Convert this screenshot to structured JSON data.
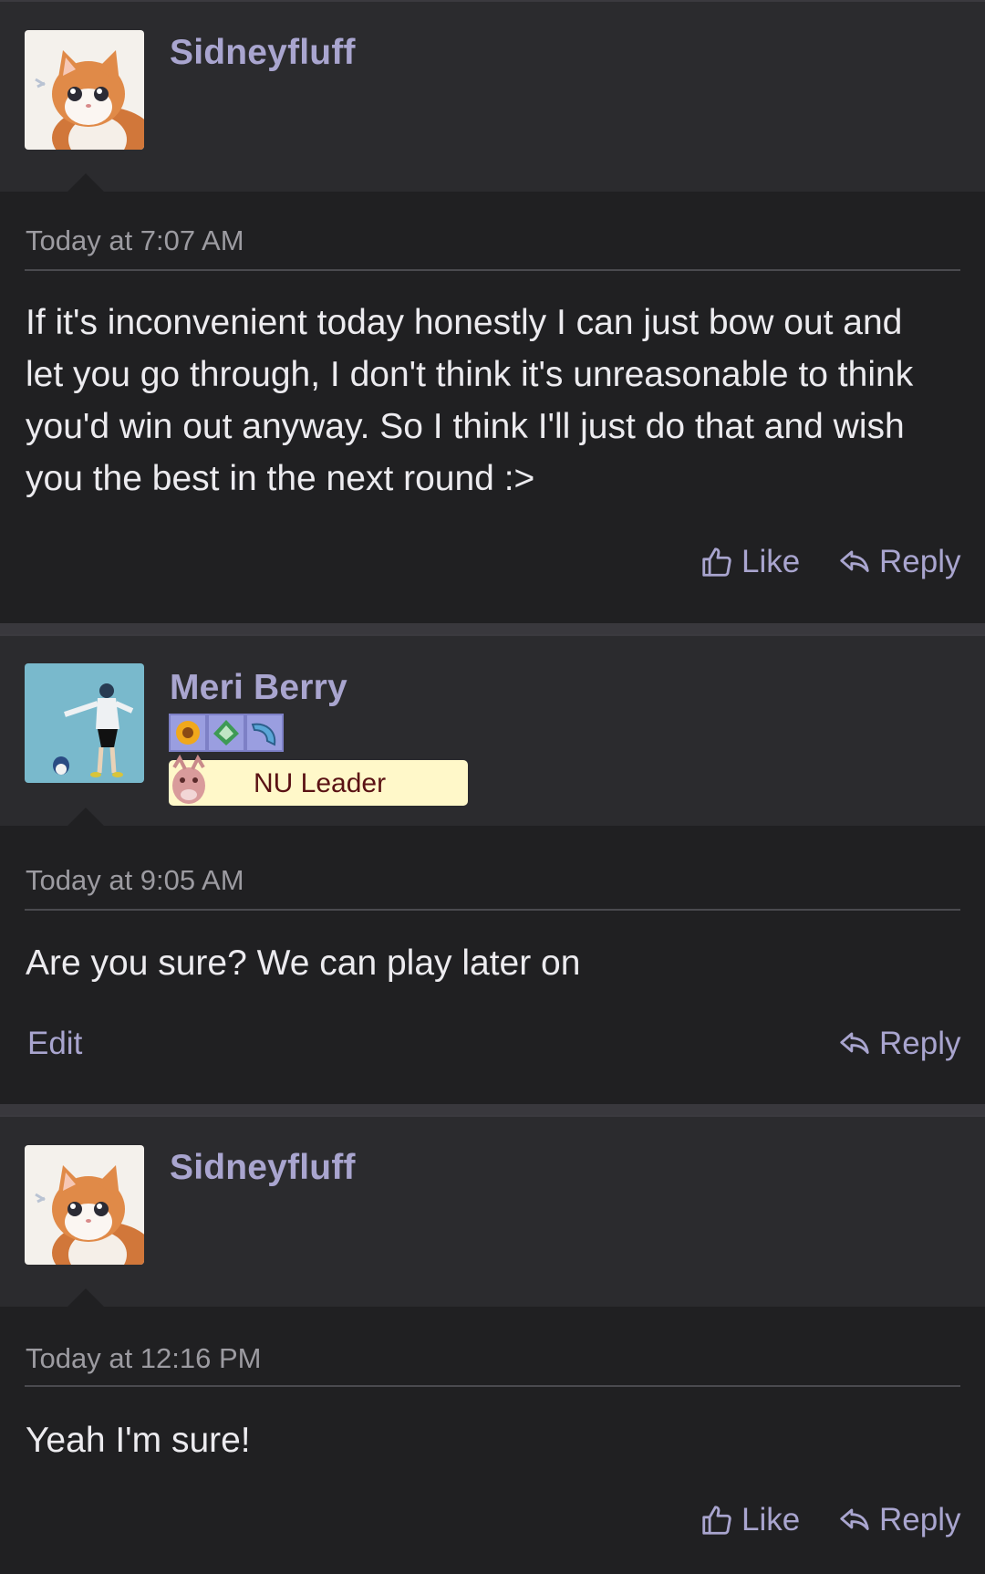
{
  "posts": [
    {
      "username": "Sidneyfluff",
      "avatar": "kitten-avatar",
      "timestamp": "Today at 7:07 AM",
      "body_lines": [
        "If it's inconvenient today honestly I can just bow out and",
        "let you go through, I don't think it's unreasonable to think",
        "you'd win out anyway. So I think I'll just do that and wish",
        "you the best in the next round :>"
      ],
      "like_label": "Like",
      "reply_label": "Reply"
    },
    {
      "username": "Meri Berry",
      "avatar": "character-avatar",
      "badges": [
        "sunflower-badge-icon",
        "leaf-badge-icon",
        "wave-badge-icon"
      ],
      "rank_label": "NU Leader",
      "timestamp": "Today at 9:05 AM",
      "body_lines": [
        "Are you sure? We can play later on"
      ],
      "edit_label": "Edit",
      "reply_label": "Reply"
    },
    {
      "username": "Sidneyfluff",
      "avatar": "kitten-avatar",
      "timestamp": "Today at 12:16 PM",
      "body_lines": [
        "Yeah I'm sure!"
      ],
      "like_label": "Like",
      "reply_label": "Reply"
    }
  ],
  "colors": {
    "background": "#202022",
    "header": "#2b2b2e",
    "accent": "#a9a5cf",
    "rank_bg": "#fff8c9",
    "rank_text": "#5a1214"
  }
}
